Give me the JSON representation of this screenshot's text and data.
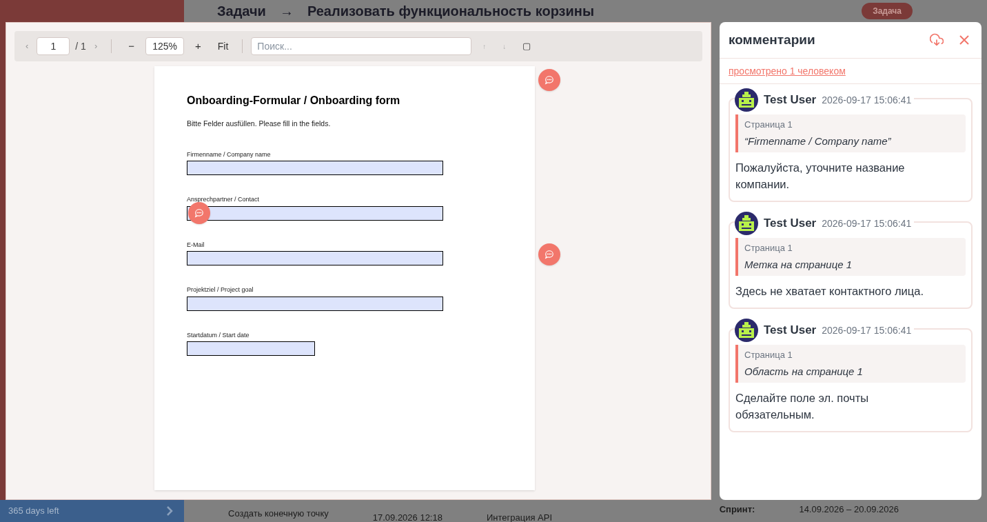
{
  "background": {
    "breadcrumb": "Задачи",
    "arrow": "→",
    "title": "Реализовать функциональность корзины",
    "new_button": "Задача",
    "plan_note": "365 days left",
    "task_name": "Создать конечную точку",
    "task_date": "17.09.2026 12:18",
    "task_tag": "Интеграция API",
    "sprint_label": "Спринт:",
    "sprint_value": "14.09.2026 – 20.09.2026"
  },
  "viewer": {
    "toolbar": {
      "prev": "‹",
      "page": "1",
      "page_total": "/ 1",
      "next": "›",
      "zoom_out": "−",
      "zoom": "125%",
      "zoom_in": "+",
      "fit": "Fit",
      "search_placeholder": "Поиск...",
      "find_prev": "↑",
      "find_next": "↓",
      "box": "▢"
    },
    "document": {
      "title": "Onboarding-Formular / Onboarding form",
      "subtitle": "Bitte Felder ausfüllen. Please fill in the fields.",
      "fields": [
        {
          "label": "Firmenname / Company name",
          "kind": "long"
        },
        {
          "label": "Ansprechpartner / Contact",
          "kind": "long"
        },
        {
          "label": "E-Mail",
          "kind": "long"
        },
        {
          "label": "Projektziel / Project goal",
          "kind": "long"
        },
        {
          "label": "Startdatum / Start date",
          "kind": "short"
        }
      ]
    }
  },
  "comments": {
    "title": "комментарии",
    "seen_link": "просмотрено 1 человеком",
    "items": [
      {
        "author": "Test User",
        "time": "2026-09-17 15:06:41",
        "page": "Страница 1",
        "quote": "“Firmenname / Company name”",
        "text": "Пожалуйста, уточните название компании."
      },
      {
        "author": "Test User",
        "time": "2026-09-17 15:06:41",
        "page": "Страница 1",
        "quote": "Метка на странице 1",
        "text": "Здесь не хватает контактного лица."
      },
      {
        "author": "Test User",
        "time": "2026-09-17 15:06:41",
        "page": "Страница 1",
        "quote": "Область на странице 1",
        "text": "Сделайте поле эл. почты обязательным."
      }
    ]
  }
}
